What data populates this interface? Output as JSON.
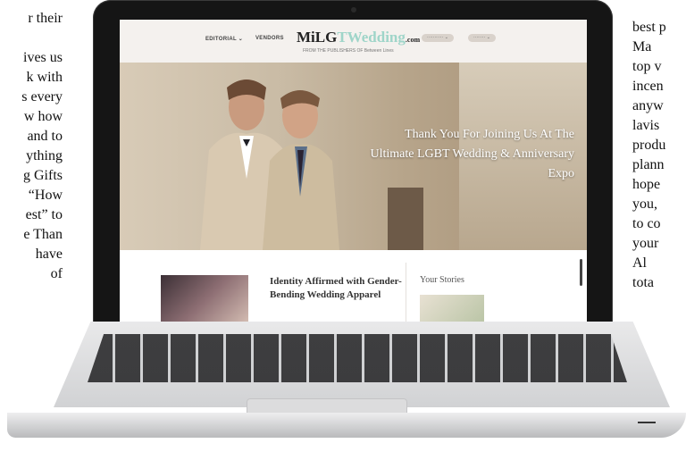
{
  "left_column": {
    "lines": [
      "r their",
      "",
      "ives us",
      "k with",
      "s every",
      "w how",
      "and to",
      "ything",
      "g Gifts",
      "“How",
      "est” to",
      "e Than",
      "have",
      "of"
    ]
  },
  "right_column": {
    "lines": [
      "best p",
      "Ma",
      "top v",
      "incen",
      "anyw",
      "lavis",
      "produ",
      "plann",
      "hope",
      "you,",
      "to co",
      "your",
      "Al",
      "tota"
    ]
  },
  "site": {
    "nav": {
      "editorial": "EDITORIAL ⌄",
      "vendors": "VENDORS",
      "logo_main": "MiLG",
      "logo_highlight": "TWedding",
      "logo_suffix": ".com",
      "logo_sub": "FROM THE PUBLISHERS OF Between Lines",
      "pill_1": "··········· ⌄",
      "pill_2": "········ ⌄"
    },
    "hero": {
      "caption": "Thank You For Joining Us At The Ultimate LGBT Wedding & Anniversary Expo"
    },
    "article": {
      "title": "Identity Affirmed with Gender-Bending Wedding Apparel"
    },
    "sidebar": {
      "title": "Your Stories"
    }
  },
  "colors": {
    "brand_accent": "#9fd5c9",
    "laptop_bezel": "#151515",
    "laptop_body": "#d1d2d4"
  }
}
